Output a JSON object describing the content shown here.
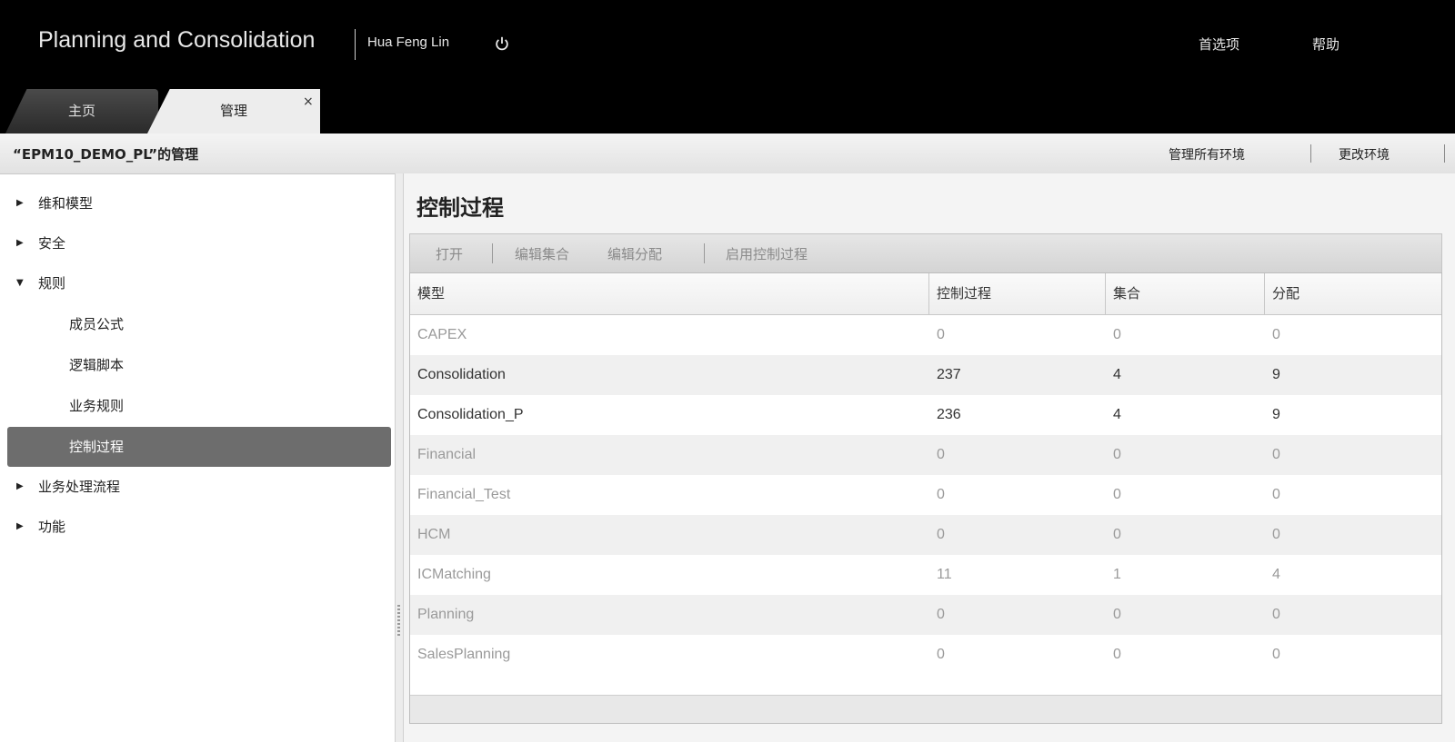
{
  "header": {
    "app_title": "Planning and Consolidation",
    "user_name": "Hua Feng Lin",
    "power_icon": "power-icon",
    "links": {
      "preferences": "首选项",
      "help": "帮助"
    }
  },
  "tabs": [
    {
      "label": "主页"
    },
    {
      "label": "管理",
      "close": "×"
    }
  ],
  "admin_bar": {
    "title": "“EPM10_DEMO_PL”的管理",
    "links": {
      "manage_all": "管理所有环境",
      "change_env": "更改环境"
    }
  },
  "nav": {
    "items": [
      {
        "label": "维和模型",
        "arrow": "▶"
      },
      {
        "label": "安全",
        "arrow": "▶"
      },
      {
        "label": "规则",
        "arrow": "▼"
      },
      {
        "label": "成员公式"
      },
      {
        "label": "逻辑脚本"
      },
      {
        "label": "业务规则"
      },
      {
        "label": "控制过程"
      },
      {
        "label": "业务处理流程",
        "arrow": "▶"
      },
      {
        "label": "功能",
        "arrow": "▶"
      }
    ]
  },
  "content": {
    "title": "控制过程",
    "toolbar": {
      "open": "打开",
      "edit_sets": "编辑集合",
      "edit_assign": "编辑分配",
      "enable": "启用控制过程"
    },
    "grid": {
      "columns": [
        "模型",
        "控制过程",
        "集合",
        "分配"
      ],
      "rows": [
        [
          "CAPEX",
          "0",
          "0",
          "0"
        ],
        [
          "Consolidation",
          "237",
          "4",
          "9"
        ],
        [
          "Consolidation_P",
          "236",
          "4",
          "9"
        ],
        [
          "Financial",
          "0",
          "0",
          "0"
        ],
        [
          "Financial_Test",
          "0",
          "0",
          "0"
        ],
        [
          "HCM",
          "0",
          "0",
          "0"
        ],
        [
          "ICMatching",
          "11",
          "1",
          "4"
        ],
        [
          "Planning",
          "0",
          "0",
          "0"
        ],
        [
          "SalesPlanning",
          "0",
          "0",
          "0"
        ]
      ]
    }
  }
}
